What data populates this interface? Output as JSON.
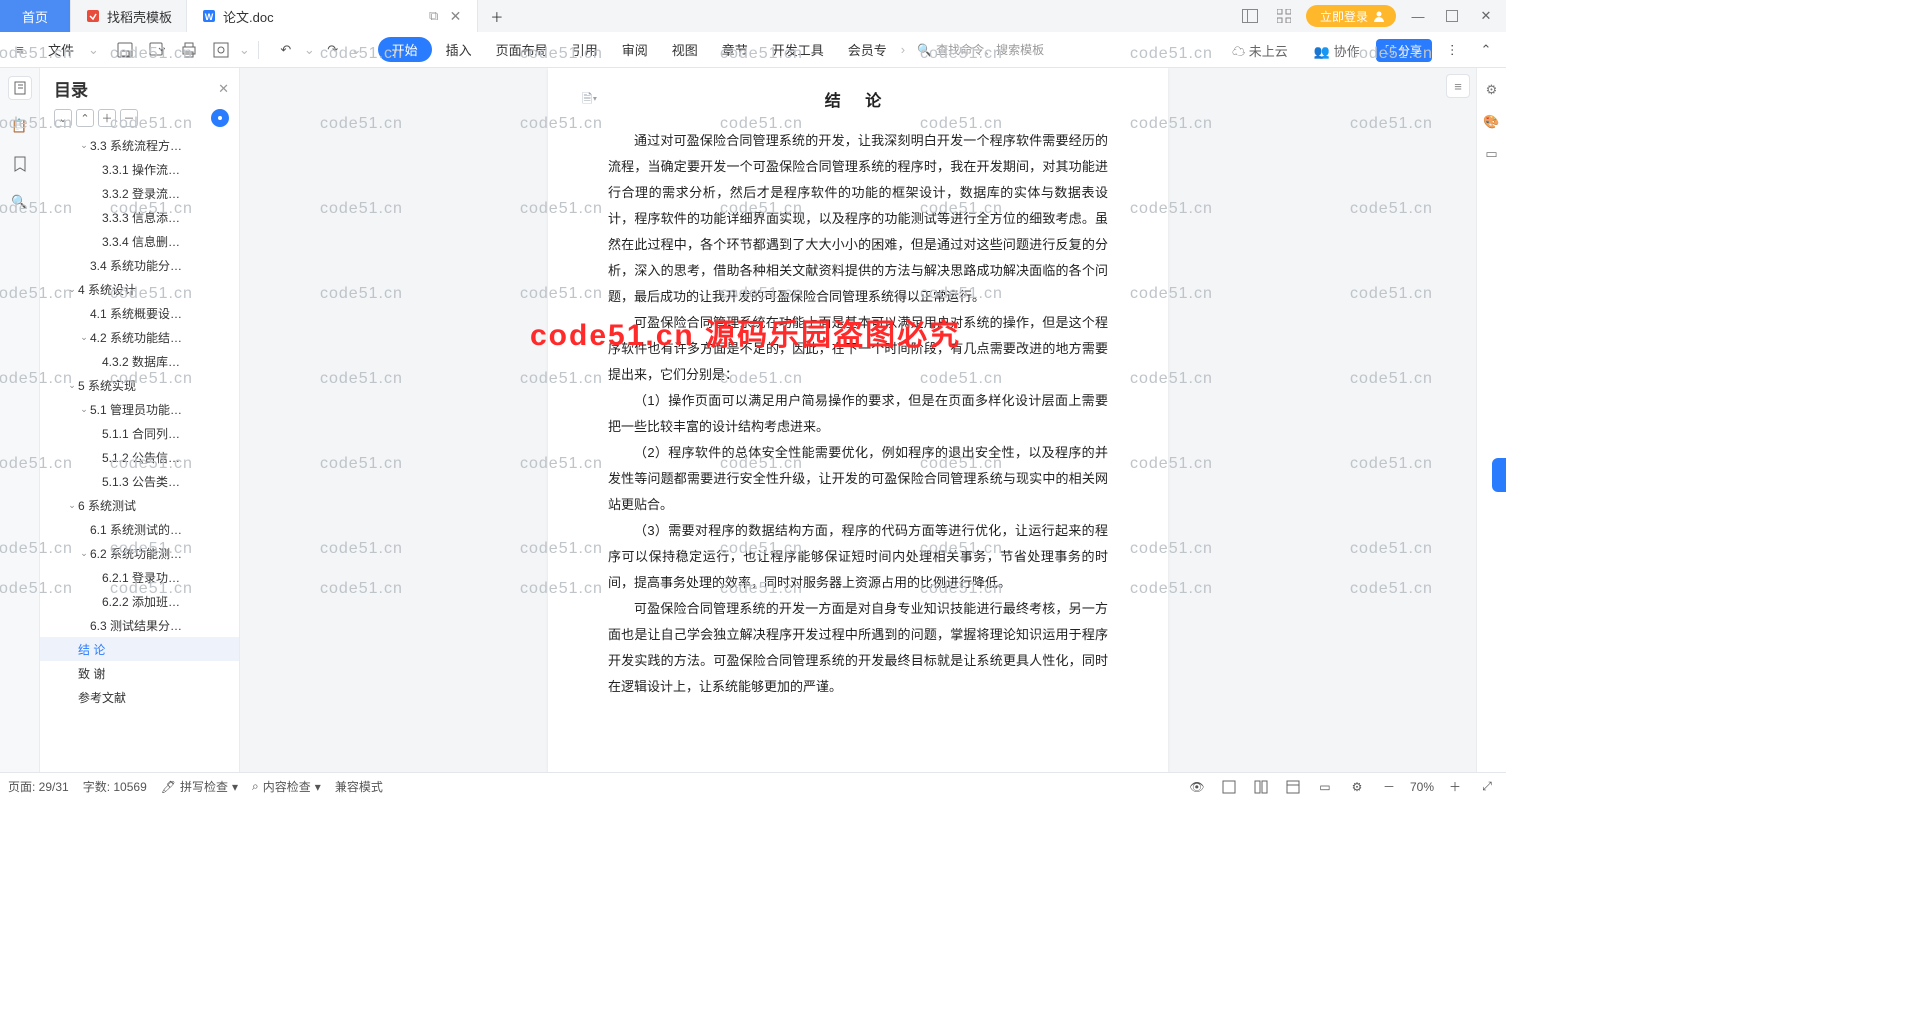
{
  "titlebar": {
    "home": "首页",
    "tab1": "找稻壳模板",
    "tab2": "论文.doc",
    "login": "立即登录"
  },
  "menubar": {
    "file": "文件",
    "start": "开始",
    "insert": "插入",
    "layout": "页面布局",
    "ref": "引用",
    "review": "审阅",
    "view": "视图",
    "chapter": "章节",
    "dev": "开发工具",
    "member": "会员专",
    "search": "查找命令、搜索模板",
    "cloud": "未上云",
    "collab": "协作",
    "share": "分享"
  },
  "outline": {
    "title": "目录",
    "items": [
      {
        "lvl": 2,
        "chev": 1,
        "t": "3.3 系统流程方…"
      },
      {
        "lvl": 3,
        "chev": 0,
        "t": "3.3.1 操作流…"
      },
      {
        "lvl": 3,
        "chev": 0,
        "t": "3.3.2 登录流…"
      },
      {
        "lvl": 3,
        "chev": 0,
        "t": "3.3.3 信息添…"
      },
      {
        "lvl": 3,
        "chev": 0,
        "t": "3.3.4 信息删…"
      },
      {
        "lvl": 2,
        "chev": 0,
        "t": "3.4 系统功能分…"
      },
      {
        "lvl": 1,
        "chev": 1,
        "t": "4 系统设计"
      },
      {
        "lvl": 2,
        "chev": 0,
        "t": "4.1 系统概要设…"
      },
      {
        "lvl": 2,
        "chev": 1,
        "t": "4.2 系统功能结…"
      },
      {
        "lvl": 3,
        "chev": 0,
        "t": "4.3.2 数据库…"
      },
      {
        "lvl": 1,
        "chev": 1,
        "t": "5 系统实现"
      },
      {
        "lvl": 2,
        "chev": 1,
        "t": "5.1 管理员功能…"
      },
      {
        "lvl": 3,
        "chev": 0,
        "t": "5.1.1 合同列…"
      },
      {
        "lvl": 3,
        "chev": 0,
        "t": "5.1.2 公告信…"
      },
      {
        "lvl": 3,
        "chev": 0,
        "t": "5.1.3 公告类…"
      },
      {
        "lvl": 1,
        "chev": 1,
        "t": "6 系统测试"
      },
      {
        "lvl": 2,
        "chev": 0,
        "t": "6.1 系统测试的…"
      },
      {
        "lvl": 2,
        "chev": 1,
        "t": "6.2 系统功能测…"
      },
      {
        "lvl": 3,
        "chev": 0,
        "t": "6.2.1 登录功…"
      },
      {
        "lvl": 3,
        "chev": 0,
        "t": "6.2.2 添加班…"
      },
      {
        "lvl": 2,
        "chev": 0,
        "t": "6.3 测试结果分…"
      },
      {
        "lvl": 1,
        "chev": 0,
        "t": "结  论",
        "sel": true
      },
      {
        "lvl": 1,
        "chev": 0,
        "t": "致  谢"
      },
      {
        "lvl": 1,
        "chev": 0,
        "t": "参考文献"
      }
    ]
  },
  "doc": {
    "title": "结  论",
    "p1": "通过对可盈保险合同管理系统的开发，让我深刻明白开发一个程序软件需要经历的流程，当确定要开发一个可盈保险合同管理系统的程序时，我在开发期间，对其功能进行合理的需求分析，然后才是程序软件的功能的框架设计，数据库的实体与数据表设计，程序软件的功能详细界面实现，以及程序的功能测试等进行全方位的细致考虑。虽然在此过程中，各个环节都遇到了大大小小的困难，但是通过对这些问题进行反复的分析，深入的思考，借助各种相关文献资料提供的方法与解决思路成功解决面临的各个问题，最后成功的让我开发的可盈保险合同管理系统得以正常运行。",
    "p2": "可盈保险合同管理系统在功能上面是基本可以满足用户对系统的操作，但是这个程序软件也有许多方面是不足的，因此，在下一个时间阶段，有几点需要改进的地方需要提出来，它们分别是：",
    "p3": "（1）操作页面可以满足用户简易操作的要求，但是在页面多样化设计层面上需要把一些比较丰富的设计结构考虑进来。",
    "p4": "（2）程序软件的总体安全性能需要优化，例如程序的退出安全性，以及程序的并发性等问题都需要进行安全性升级，让开发的可盈保险合同管理系统与现实中的相关网站更贴合。",
    "p5": "（3）需要对程序的数据结构方面，程序的代码方面等进行优化，让运行起来的程序可以保持稳定运行，也让程序能够保证短时间内处理相关事务，节省处理事务的时间，提高事务处理的效率，同时对服务器上资源占用的比例进行降低。",
    "p6": "可盈保险合同管理系统的开发一方面是对自身专业知识技能进行最终考核，另一方面也是让自己学会独立解决程序开发过程中所遇到的问题，掌握将理论知识运用于程序开发实践的方法。可盈保险合同管理系统的开发最终目标就是让系统更具人性化，同时在逻辑设计上，让系统能够更加的严谨。"
  },
  "status": {
    "page": "页面: 29/31",
    "words": "字数: 10569",
    "spell": "拼写检查",
    "content": "内容检查",
    "compat": "兼容模式",
    "zoom": "70%"
  },
  "watermark": {
    "text": "code51.cn",
    "red": "code51.cn 源码乐园盗图必究"
  }
}
